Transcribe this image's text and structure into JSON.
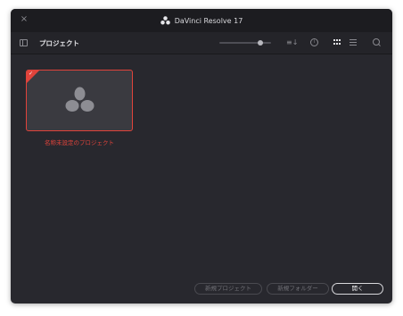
{
  "window": {
    "title": "DaVinci Resolve 17",
    "close_glyph": "×",
    "icon": "davinci-resolve-logo-icon"
  },
  "toolbar": {
    "title": "プロジェクト",
    "zoom_level": 0.8,
    "icons": [
      "panel-toggle-icon",
      "sort-icon",
      "info-icon",
      "grid-view-icon",
      "list-view-icon",
      "search-icon"
    ],
    "sort_glyph": "≡↓",
    "info_glyph": "i"
  },
  "projects": [
    {
      "name": "名称未設定のプロジェクト",
      "selected": true,
      "check_glyph": "✓"
    }
  ],
  "footer": {
    "new_project": "新規プロジェクト",
    "new_folder": "新規フォルダー",
    "open": "開く"
  },
  "colors": {
    "accent": "#e0433b",
    "window_bg": "#28282e",
    "titlebar_bg": "#1c1c20"
  }
}
